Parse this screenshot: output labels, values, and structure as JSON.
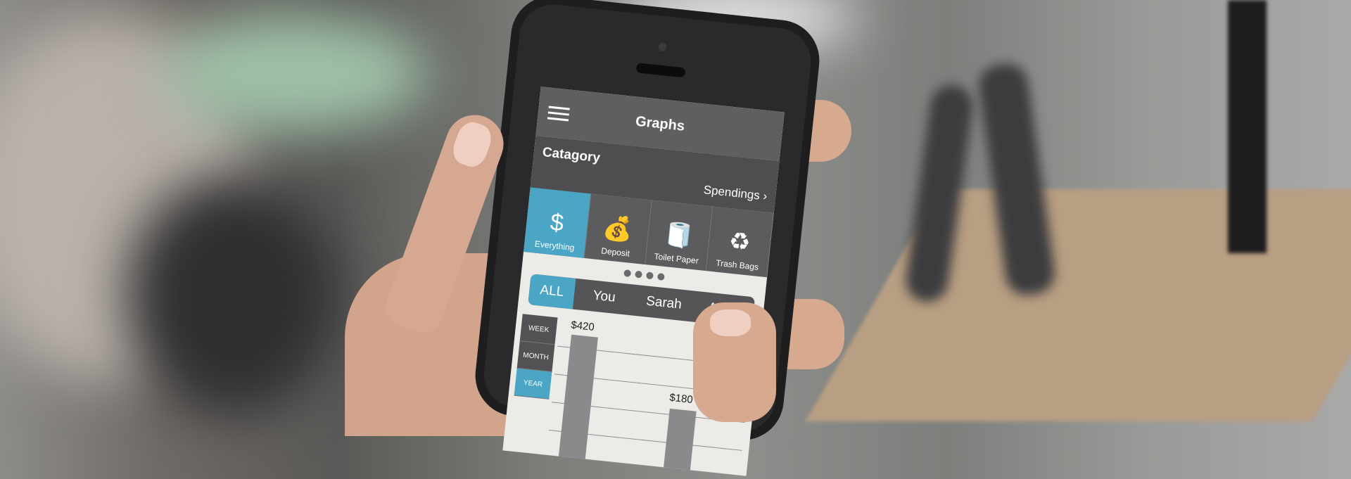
{
  "app": {
    "title": "Graphs"
  },
  "category": {
    "title": "Catagory",
    "filter_label": "Spendings",
    "items": [
      {
        "label": "Everything",
        "icon": "dollar-badge-icon",
        "active": true
      },
      {
        "label": "Deposit",
        "icon": "money-bag-icon",
        "active": false
      },
      {
        "label": "Toilet Paper",
        "icon": "toilet-paper-icon",
        "active": false
      },
      {
        "label": "Trash Bags",
        "icon": "trash-bag-icon",
        "active": false
      }
    ],
    "page_indicator_count": 4
  },
  "people_filter": {
    "options": [
      "ALL",
      "You",
      "Sarah",
      "Anne"
    ],
    "selected": "ALL"
  },
  "period_filter": {
    "options": [
      "WEEK",
      "MONTH",
      "YEAR"
    ],
    "selected": "YEAR"
  },
  "chart_data": {
    "type": "bar",
    "values_labels": [
      "$420",
      "$180"
    ],
    "values": [
      420,
      180
    ]
  },
  "colors": {
    "accent": "#4aa6c4",
    "bar_dark": "#5f5f61"
  }
}
